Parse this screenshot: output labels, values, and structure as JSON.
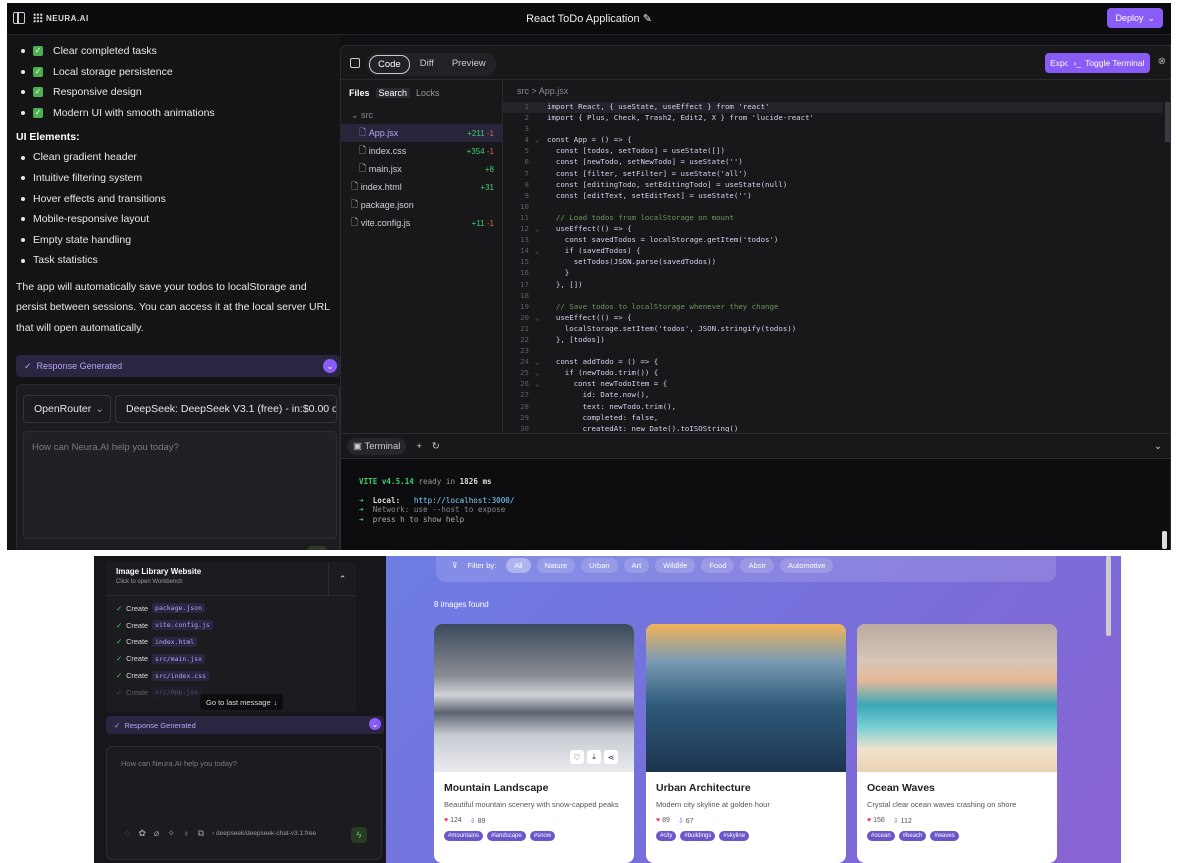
{
  "app": {
    "logo": "NEURA.AI",
    "title": "React ToDo Application",
    "deploy_label": "Deploy"
  },
  "chat": {
    "features": [
      "Clear completed tasks",
      "Local storage persistence",
      "Responsive design",
      "Modern UI with smooth animations"
    ],
    "ui_heading": "UI Elements:",
    "ui_items": [
      "Clean gradient header",
      "Intuitive filtering system",
      "Hover effects and transitions",
      "Mobile-responsive layout",
      "Empty state handling",
      "Task statistics"
    ],
    "paragraph": "The app will automatically save your todos to localStorage and persist between sessions. You can access it at the local server URL that will open automatically.",
    "response_generated": "Response Generated",
    "provider": "OpenRouter",
    "model": "DeepSeek: DeepSeek V3.1 (free) - in:$0.00 o...",
    "placeholder": "How can Neura.AI help you today?"
  },
  "workbench": {
    "tabs": [
      "Code",
      "Diff",
      "Preview"
    ],
    "export_label": "Export",
    "toggle_terminal_label": "Toggle Terminal",
    "file_tabs": [
      "Files",
      "Search",
      "Locks"
    ],
    "folder": "src",
    "files": [
      {
        "name": "App.jsx",
        "add": "+211",
        "del": "-1",
        "indent": true,
        "selected": true
      },
      {
        "name": "index.css",
        "add": "+354",
        "del": "-1",
        "indent": true
      },
      {
        "name": "main.jsx",
        "add": "+8",
        "del": "",
        "indent": true
      },
      {
        "name": "index.html",
        "add": "+31",
        "del": "",
        "indent": false
      },
      {
        "name": "package.json",
        "add": "",
        "del": "",
        "indent": false
      },
      {
        "name": "vite.config.js",
        "add": "+11",
        "del": "-1",
        "indent": false
      }
    ],
    "breadcrumb": "src  >  App.jsx",
    "code": [
      "import React, { useState, useEffect } from 'react'",
      "import { Plus, Check, Trash2, Edit2, X } from 'lucide-react'",
      "",
      "const App = () => {",
      "  const [todos, setTodos] = useState([])",
      "  const [newTodo, setNewTodo] = useState('')",
      "  const [filter, setFilter] = useState('all')",
      "  const [editingTodo, setEditingTodo] = useState(null)",
      "  const [editText, setEditText] = useState('')",
      "",
      "  // Load todos from localStorage on mount",
      "  useEffect(() => {",
      "    const savedTodos = localStorage.getItem('todos')",
      "    if (savedTodos) {",
      "      setTodos(JSON.parse(savedTodos))",
      "    }",
      "  }, [])",
      "",
      "  // Save todos to localStorage whenever they change",
      "  useEffect(() => {",
      "    localStorage.setItem('todos', JSON.stringify(todos))",
      "  }, [todos])",
      "",
      "  const addTodo = () => {",
      "    if (newTodo.trim()) {",
      "      const newTodoItem = {",
      "        id: Date.now(),",
      "        text: newTodo.trim(),",
      "        completed: false,",
      "        createdAt: new Date().toISOString()"
    ],
    "fold_lines": [
      4,
      12,
      14,
      20,
      24,
      25,
      26
    ],
    "terminal_label": "Terminal",
    "terminal": {
      "vite": "VITE v4.5.14",
      "ready": "ready in",
      "ms": "1826 ms",
      "local_label": "Local:",
      "local_url": "http://localhost:3000/",
      "network": "Network: use --host to expose",
      "help": "press h to show help"
    }
  },
  "second": {
    "task_title": "Image Library Website",
    "task_sub": "Click to open Workbench",
    "steps": [
      "package.json",
      "vite.config.js",
      "index.html",
      "src/main.jsx",
      "src/index.css",
      "src/App.jsx"
    ],
    "create_label": "Create",
    "goto_last": "Go to last message",
    "response_generated": "Response Generated",
    "placeholder": "How can Neura.AI help you today?",
    "model_short": "deepseek/deepseek-chat-v3.1:free",
    "filter_label": "Filter by:",
    "filters": [
      "All",
      "Nature",
      "Urban",
      "Art",
      "Wildlife",
      "Food",
      "Abstr",
      "Automotive"
    ],
    "found": "8 images found",
    "cards": [
      {
        "title": "Mountain Landscape",
        "desc": "Beautiful mountain scenery with snow-capped peaks",
        "likes": "124",
        "downloads": "89",
        "tags": [
          "#mountains",
          "#landscape",
          "#snow"
        ]
      },
      {
        "title": "Urban Architecture",
        "desc": "Modern city skyline at golden hour",
        "likes": "89",
        "downloads": "67",
        "tags": [
          "#city",
          "#buildings",
          "#skyline"
        ]
      },
      {
        "title": "Ocean Waves",
        "desc": "Crystal clear ocean waves crashing on shore",
        "likes": "156",
        "downloads": "112",
        "tags": [
          "#ocean",
          "#beach",
          "#waves"
        ]
      }
    ]
  }
}
